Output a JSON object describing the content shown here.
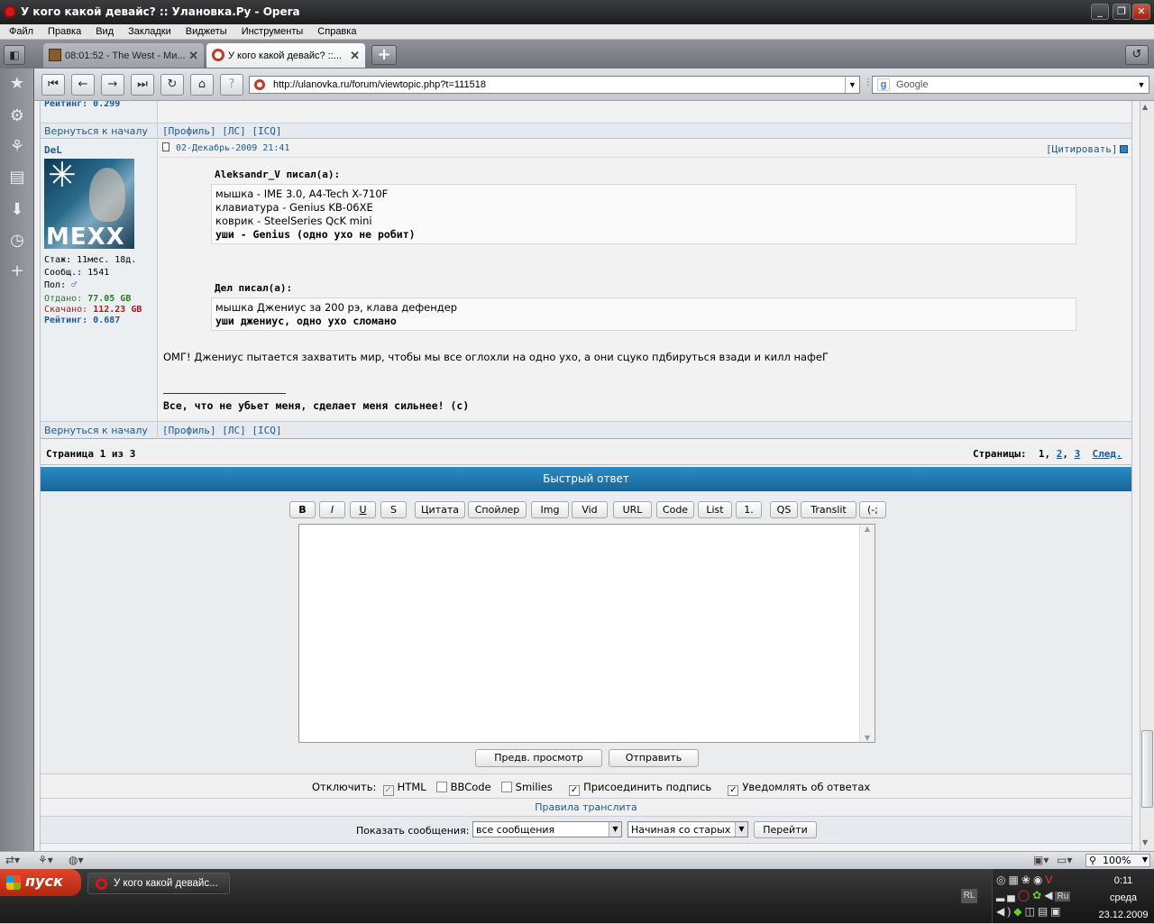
{
  "window": {
    "title": "У кого какой девайс? :: Улановка.Ру - Opera"
  },
  "menu": [
    "Файл",
    "Правка",
    "Вид",
    "Закладки",
    "Виджеты",
    "Инструменты",
    "Справка"
  ],
  "tabs": [
    {
      "label": "08:01:52 - The West - Ми...",
      "active": false
    },
    {
      "label": "У кого какой девайс? ::...",
      "active": true
    }
  ],
  "address": {
    "url": "http://ulanovka.ru/forum/viewtopic.php?t=111518",
    "search_engine": "Google"
  },
  "prev_post": {
    "rating": "Рейтинг: 0.299",
    "back_to_top": "Вернуться к началу",
    "links": "[Профиль] [ЛС] [ICQ]"
  },
  "post": {
    "author": "DeL",
    "avatar_text": "MEXX",
    "stats": {
      "stazh": "Стаж: 11мес. 18д.",
      "posts": "Сообщ.: 1541",
      "gender": "Пол:",
      "gender_symbol": "♂",
      "given_label": "Отдано:",
      "given_value": "77.05 GB",
      "downloaded_label": "Скачано:",
      "downloaded_value": "112.23 GB",
      "rating": "Рейтинг: 0.687"
    },
    "date": "02-Декабрь-2009 21:41",
    "quote_button": "[Цитировать]",
    "quote1": {
      "header": "Aleksandr_V писал(а):",
      "lines": [
        "мышка - IME 3.0, A4-Tech X-710F",
        "клавиатура - Genius KB-06XE",
        "коврик - SteelSeries QcK mini"
      ],
      "bold_line": "уши - Genius (одно ухо не робит)"
    },
    "quote2": {
      "header": "Дел писал(а):",
      "line": "мышка Джениус за 200 рэ, клава дефендер",
      "bold_line": "уши джениус, одно ухо сломано"
    },
    "body": "ОМГ! Джениус пытается захватить мир, чтобы мы все оглохли на одно ухо, а они сцуко пдбируться взади и килл нафеГ",
    "signature": "Все, что не убьет меня, сделает меня сильнее! (c)",
    "back_to_top": "Вернуться к началу",
    "links": "[Профиль] [ЛС] [ICQ]"
  },
  "pagination": {
    "left": "Страница 1 из 3",
    "label": "Страницы:",
    "current": "1",
    "p2": "2",
    "p3": "3",
    "next": "След."
  },
  "quick_reply": {
    "title": "Быстрый ответ",
    "toolbar": [
      "B",
      "I",
      "U",
      "S",
      "Цитата",
      "Спойлер",
      "Img",
      "Vid",
      "URL",
      "Code",
      "List",
      "1.",
      "QS",
      "Translit",
      "(-;"
    ],
    "preview": "Предв. просмотр",
    "submit": "Отправить",
    "disable_label": "Отключить:",
    "opt_html": "HTML",
    "opt_bbcode": "BBCode",
    "opt_smilies": "Smilies",
    "opt_signature": "Присоединить подпись",
    "opt_notify": "Уведомлять об ответах",
    "translit_rules": "Правила транслита"
  },
  "display": {
    "label": "Показать сообщения:",
    "filter_value": "все сообщения",
    "order_value": "Начиная со старых",
    "go_button": "Перейти"
  },
  "statusbar": {
    "zoom": "100%"
  },
  "taskbar": {
    "start": "пуск",
    "task": "У кого какой девайс...",
    "lang": "RL",
    "time": "0:11",
    "day": "среда",
    "date": "23.12.2009",
    "tray_lang": "Ru"
  }
}
